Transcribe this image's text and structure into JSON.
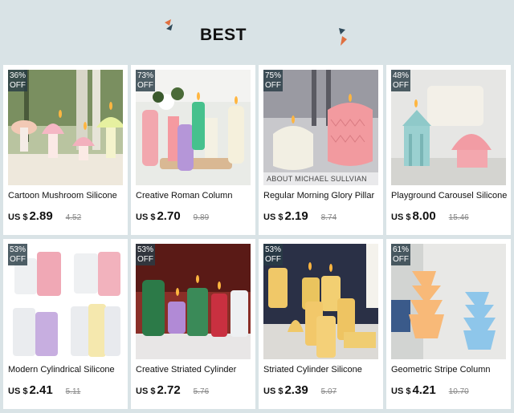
{
  "section": {
    "title": "BEST"
  },
  "products": [
    {
      "discount": "36%",
      "off": "OFF",
      "name": "Cartoon Mushroom Silicone",
      "currency": "US $",
      "price": "2.89",
      "old_price": "4.52"
    },
    {
      "discount": "73%",
      "off": "OFF",
      "name": "Creative Roman Column",
      "currency": "US $",
      "price": "2.70",
      "old_price": "9.89"
    },
    {
      "discount": "75%",
      "off": "OFF",
      "name": "Regular Morning Glory Pillar",
      "currency": "US $",
      "price": "2.19",
      "old_price": "8.74",
      "watermark": "ABOUT MICHAEL SULLVIAN"
    },
    {
      "discount": "48%",
      "off": "OFF",
      "name": "Playground Carousel Silicone",
      "currency": "US $",
      "price": "8.00",
      "old_price": "15.46"
    },
    {
      "discount": "53%",
      "off": "OFF",
      "name": "Modern Cylindrical Silicone",
      "currency": "US $",
      "price": "2.41",
      "old_price": "5.11"
    },
    {
      "discount": "53%",
      "off": "OFF",
      "name": "Creative Striated Cylinder",
      "currency": "US $",
      "price": "2.72",
      "old_price": "5.76"
    },
    {
      "discount": "53%",
      "off": "OFF",
      "name": "Striated Cylinder Silicone",
      "currency": "US $",
      "price": "2.39",
      "old_price": "5.07"
    },
    {
      "discount": "61%",
      "off": "OFF",
      "name": "Geometric Stripe Column",
      "currency": "US $",
      "price": "4.21",
      "old_price": "10.70"
    }
  ]
}
